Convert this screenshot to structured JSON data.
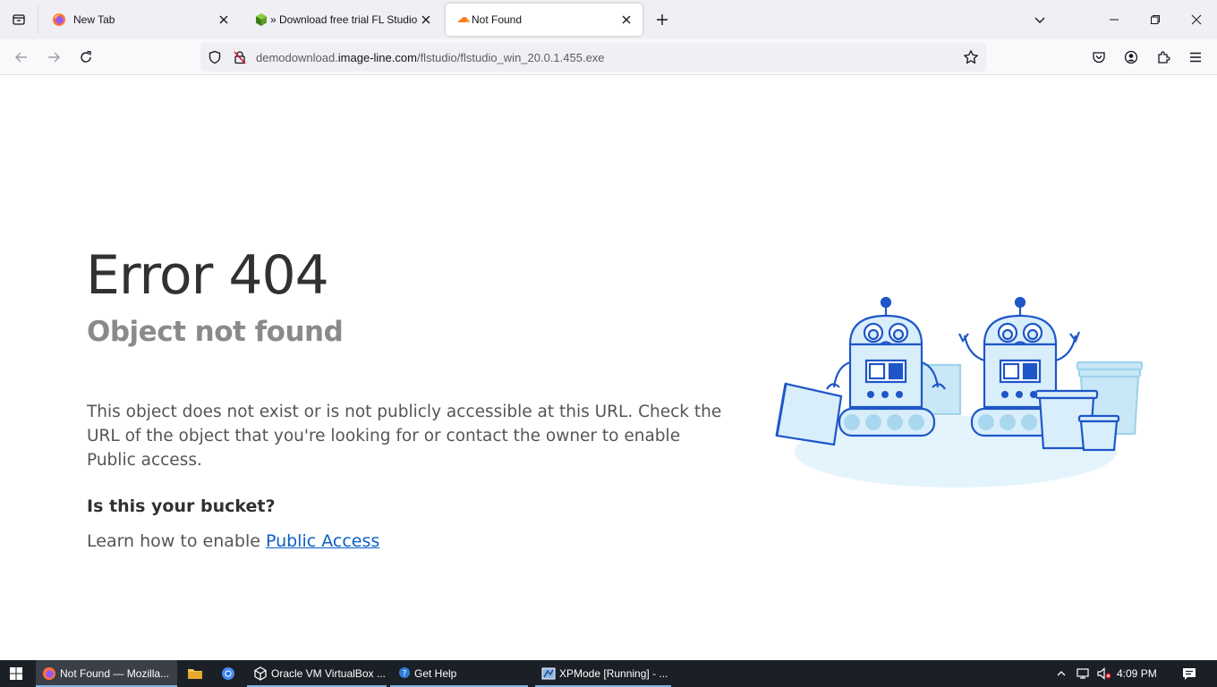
{
  "browser": {
    "tabs": [
      {
        "title": "New Tab",
        "icon": "firefox-icon"
      },
      {
        "title": "» Download free trial FL Studio",
        "icon": "fl-studio-icon"
      },
      {
        "title": "Not Found",
        "icon": "cloudflare-icon"
      }
    ],
    "url": {
      "prefix": "demodownload.",
      "domain": "image-line.com",
      "path": "/flstudio/flstudio_win_20.0.1.455.exe"
    }
  },
  "page": {
    "title": "Error 404",
    "subtitle": "Object not found",
    "description": "This object does not exist or is not publicly accessible at this URL. Check the URL of the object that you're looking for or contact the owner to enable Public access.",
    "bucket_heading": "Is this your bucket?",
    "bucket_text": "Learn how to enable ",
    "bucket_link": "Public Access"
  },
  "taskbar": {
    "items": [
      {
        "label": "Not Found — Mozilla...",
        "icon": "firefox-icon",
        "active": true
      },
      {
        "label": "Oracle VM VirtualBox ...",
        "icon": "virtualbox-icon"
      },
      {
        "label": "Get Help",
        "icon": "help-icon"
      },
      {
        "label": "XPMode [Running] - ...",
        "icon": "vm-window-icon"
      }
    ],
    "clock": "4:09 PM"
  },
  "colors": {
    "accent_link": "#0b5fc4",
    "robot_blue": "#1e56c8",
    "robot_fill": "#d9eefb"
  }
}
